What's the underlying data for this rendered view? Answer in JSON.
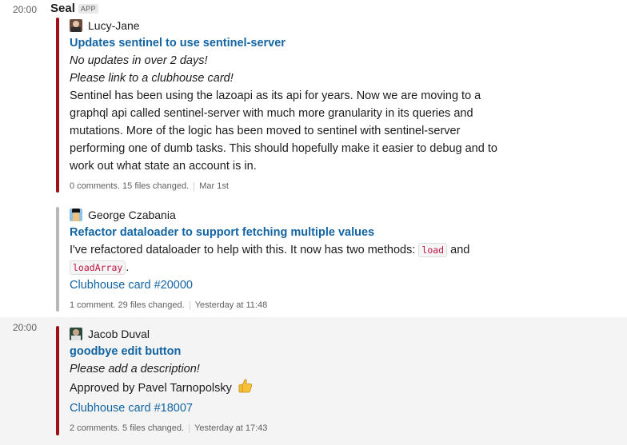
{
  "group1": {
    "time": "20:00",
    "sender": "Seal",
    "badge": "APP",
    "attachments": [
      {
        "author": "Lucy-Jane",
        "title": "Updates sentinel to use sentinel-server",
        "warnings": [
          "No updates in over 2 days!",
          "Please link to a clubhouse card!"
        ],
        "body": [
          "Sentinel has been using the lazoapi as its api for years. Now we are moving to a",
          "graphql api called sentinel-server with much more granularity in its queries and",
          "mutations. More of the logic has been moved to sentinel with sentinel-server",
          "performing one of dumb tasks. This should hopefully make it easier to debug and to",
          "work out what state an account is in."
        ],
        "stats": "0 comments. 15 files changed.",
        "date": "Mar 1st"
      },
      {
        "author": "George Czabania",
        "title": "Refactor dataloader to support fetching multiple values",
        "body_pre": "I've refactored dataloader to help with this. It now has two methods:",
        "code1": "load",
        "body_and": "and",
        "code2": "loadArray",
        "body_end": ".",
        "card_link": "Clubhouse card #20000",
        "stats": "1 comment. 29 files changed.",
        "date": "Yesterday at 11:48"
      }
    ]
  },
  "group2": {
    "time": "20:00",
    "attachment": {
      "author": "Jacob Duval",
      "title": "goodbye edit button",
      "warning": "Please add a description!",
      "approved": "Approved by Pavel Tarnopolsky",
      "card_link": "Clubhouse card #18007",
      "stats": "2 comments. 5 files changed.",
      "date": "Yesterday at 17:43"
    }
  },
  "icons": {
    "thumbs_up": "thumbs-up-emoji"
  },
  "colors": {
    "link": "#1264a3",
    "bar_red": "#a0101a",
    "bar_grey": "#b7b7b7",
    "code_text": "#c01343"
  }
}
